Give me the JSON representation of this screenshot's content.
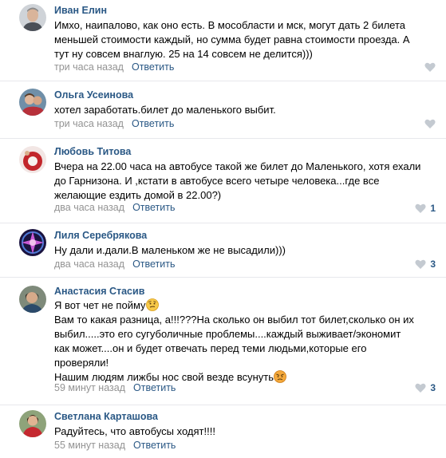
{
  "comments": [
    {
      "author": "Иван Елин",
      "lines": [
        "Имхо, наипалово, как оно есть. В мособласти и мск, могут дать 2 билета",
        "меньшей стоимости каждый, но сумма будет равна стоимости проезда. А",
        "тут ну совсем внаглую. 25 на 14 совсем не делится)))"
      ],
      "time": "три часа назад",
      "reply": "Ответить",
      "likes": ""
    },
    {
      "author": "Ольга Усеинова",
      "lines": [
        "хотел заработать.билет до маленького выбит."
      ],
      "time": "три часа назад",
      "reply": "Ответить",
      "likes": ""
    },
    {
      "author": "Любовь Титова",
      "lines": [
        "Вчера на 22.00 часа на автобусе такой же билет до Маленького, хотя ехали",
        "до Гарнизона. И ,кстати в автобусе всего четыре человека...где все",
        "желающие ездить домой в 22.00?)"
      ],
      "time": "два часа назад",
      "reply": "Ответить",
      "likes": "1"
    },
    {
      "author": "Лиля Серебрякова",
      "lines": [
        "Ну дали и.дали.В маленьком же не высадили)))"
      ],
      "time": "два часа назад",
      "reply": "Ответить",
      "likes": "3"
    },
    {
      "author": "Анастасия Стасив",
      "line1": "Я вот чет не пойму",
      "lines_mid": [
        "Вам то какая разница, а!!!???На сколько он выбил тот билет,сколько он их",
        "выбил.....это его сугуболичные проблемы....каждый выживает/экономит",
        "как может....он и будет отвечать перед теми людьми,которые его",
        "проверяли!"
      ],
      "line_last": "Нашим людям лижбы нос свой везде всунуть",
      "emoji1": "thinking-face",
      "emoji2": "angry-face",
      "time": "59 минут назад",
      "reply": "Ответить",
      "likes": "3"
    },
    {
      "author": "Светлана Карташова",
      "lines": [
        "Радуйтесь, что автобусы ходят!!!!"
      ],
      "time": "55 минут назад",
      "reply": "Ответить",
      "likes": ""
    }
  ],
  "icons": {
    "like": "heart-icon"
  },
  "colors": {
    "link": "#2a5885",
    "meta": "#939393",
    "divider": "#e7e8ec"
  }
}
